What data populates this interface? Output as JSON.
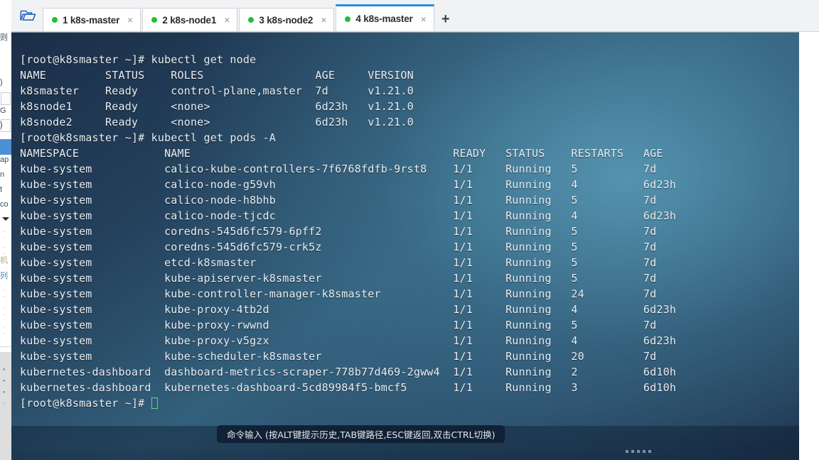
{
  "window": {
    "folder_icon": "open-folder-icon",
    "new_tab_label": "+"
  },
  "tabs": [
    {
      "label": "1 k8s-master",
      "status_color": "#22c032",
      "close": "×",
      "active": false
    },
    {
      "label": "2 k8s-node1",
      "status_color": "#22c032",
      "close": "×",
      "active": false
    },
    {
      "label": "3 k8s-node2",
      "status_color": "#22c032",
      "close": "×",
      "active": false
    },
    {
      "label": "4 k8s-master",
      "status_color": "#22c032",
      "close": "×",
      "active": true
    }
  ],
  "terminal": {
    "lines": [
      "[root@k8smaster ~]# kubectl get node",
      "NAME         STATUS    ROLES                 AGE     VERSION",
      "k8smaster    Ready     control-plane,master  7d      v1.21.0",
      "k8snode1     Ready     <none>                6d23h   v1.21.0",
      "k8snode2     Ready     <none>                6d23h   v1.21.0",
      "[root@k8smaster ~]# kubectl get pods -A",
      "NAMESPACE             NAME                                        READY   STATUS    RESTARTS   AGE",
      "kube-system           calico-kube-controllers-7f6768fdfb-9rst8    1/1     Running   5          7d",
      "kube-system           calico-node-g59vh                           1/1     Running   4          6d23h",
      "kube-system           calico-node-h8bhb                           1/1     Running   5          7d",
      "kube-system           calico-node-tjcdc                           1/1     Running   4          6d23h",
      "kube-system           coredns-545d6fc579-6pff2                    1/1     Running   5          7d",
      "kube-system           coredns-545d6fc579-crk5z                    1/1     Running   5          7d",
      "kube-system           etcd-k8smaster                              1/1     Running   5          7d",
      "kube-system           kube-apiserver-k8smaster                    1/1     Running   5          7d",
      "kube-system           kube-controller-manager-k8smaster           1/1     Running   24         7d",
      "kube-system           kube-proxy-4tb2d                            1/1     Running   4          6d23h",
      "kube-system           kube-proxy-rwwnd                            1/1     Running   5          7d",
      "kube-system           kube-proxy-v5gzx                            1/1     Running   4          6d23h",
      "kube-system           kube-scheduler-k8smaster                    1/1     Running   20         7d",
      "kubernetes-dashboard  dashboard-metrics-scraper-778b77d469-2gww4  1/1     Running   2          6d10h",
      "kubernetes-dashboard  kubernetes-dashboard-5cd89984f5-bmcf5       1/1     Running   3          6d10h"
    ],
    "prompt": "[root@k8smaster ~]# ",
    "cursor_color": "#4fe07a",
    "node_table": {
      "columns": [
        "NAME",
        "STATUS",
        "ROLES",
        "AGE",
        "VERSION"
      ],
      "rows": [
        [
          "k8smaster",
          "Ready",
          "control-plane,master",
          "7d",
          "v1.21.0"
        ],
        [
          "k8snode1",
          "Ready",
          "<none>",
          "6d23h",
          "v1.21.0"
        ],
        [
          "k8snode2",
          "Ready",
          "<none>",
          "6d23h",
          "v1.21.0"
        ]
      ]
    },
    "pods_table": {
      "columns": [
        "NAMESPACE",
        "NAME",
        "READY",
        "STATUS",
        "RESTARTS",
        "AGE"
      ],
      "rows": [
        [
          "kube-system",
          "calico-kube-controllers-7f6768fdfb-9rst8",
          "1/1",
          "Running",
          "5",
          "7d"
        ],
        [
          "kube-system",
          "calico-node-g59vh",
          "1/1",
          "Running",
          "4",
          "6d23h"
        ],
        [
          "kube-system",
          "calico-node-h8bhb",
          "1/1",
          "Running",
          "5",
          "7d"
        ],
        [
          "kube-system",
          "calico-node-tjcdc",
          "1/1",
          "Running",
          "4",
          "6d23h"
        ],
        [
          "kube-system",
          "coredns-545d6fc579-6pff2",
          "1/1",
          "Running",
          "5",
          "7d"
        ],
        [
          "kube-system",
          "coredns-545d6fc579-crk5z",
          "1/1",
          "Running",
          "5",
          "7d"
        ],
        [
          "kube-system",
          "etcd-k8smaster",
          "1/1",
          "Running",
          "5",
          "7d"
        ],
        [
          "kube-system",
          "kube-apiserver-k8smaster",
          "1/1",
          "Running",
          "5",
          "7d"
        ],
        [
          "kube-system",
          "kube-controller-manager-k8smaster",
          "1/1",
          "Running",
          "24",
          "7d"
        ],
        [
          "kube-system",
          "kube-proxy-4tb2d",
          "1/1",
          "Running",
          "4",
          "6d23h"
        ],
        [
          "kube-system",
          "kube-proxy-rwwnd",
          "1/1",
          "Running",
          "5",
          "7d"
        ],
        [
          "kube-system",
          "kube-proxy-v5gzx",
          "1/1",
          "Running",
          "4",
          "6d23h"
        ],
        [
          "kube-system",
          "kube-scheduler-k8smaster",
          "1/1",
          "Running",
          "20",
          "7d"
        ],
        [
          "kubernetes-dashboard",
          "dashboard-metrics-scraper-778b77d469-2gww4",
          "1/1",
          "Running",
          "2",
          "6d10h"
        ],
        [
          "kubernetes-dashboard",
          "kubernetes-dashboard-5cd89984f5-bmcf5",
          "1/1",
          "Running",
          "3",
          "6d10h"
        ]
      ]
    },
    "commands": [
      "kubectl get node",
      "kubectl get pods -A"
    ]
  },
  "status_hint": "命令输入 (按ALT键提示历史,TAB键路径,ESC键返回,双击CTRL切换)",
  "left_strip": {
    "fragments": [
      "则",
      ")",
      "G",
      ")",
      "ap",
      "n",
      "t",
      "co",
      "机",
      "列"
    ]
  }
}
